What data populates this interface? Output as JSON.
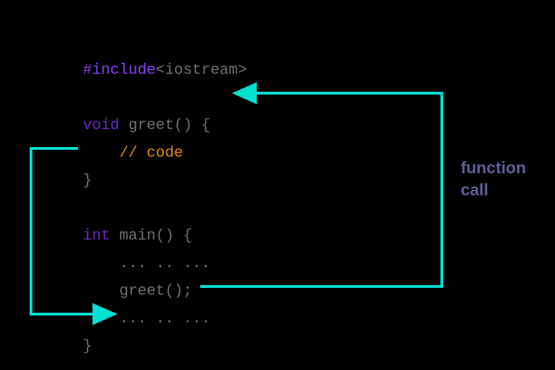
{
  "code": {
    "l1_include": "#include",
    "l1_header": "<iostream>",
    "l3_void": "void",
    "l3_name": " greet() ",
    "l3_brace": "{",
    "l4_indent": "    ",
    "l4_comment": "// code",
    "l5_brace": "}",
    "l7_int": "int",
    "l7_name": " main() ",
    "l7_brace": "{",
    "l8_indent": "    ",
    "l8_dots": "... .. ...",
    "l9_indent": "    ",
    "l9_call": "greet();",
    "l10_indent": "    ",
    "l10_dots": "... .. ...",
    "l11_brace": "}"
  },
  "annotation": {
    "line1": "function",
    "line2": "call"
  },
  "arrows": {
    "color": "#00e0d1"
  }
}
